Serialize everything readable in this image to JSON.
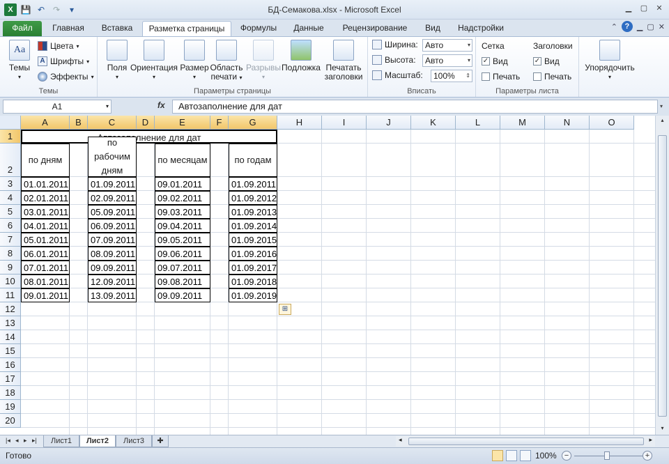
{
  "window": {
    "title": "БД-Семакова.xlsx - Microsoft Excel"
  },
  "ribbon_tabs": [
    "Файл",
    "Главная",
    "Вставка",
    "Разметка страницы",
    "Формулы",
    "Данные",
    "Рецензирование",
    "Вид",
    "Надстройки"
  ],
  "ribbon": {
    "themes": {
      "themes_label": "Темы",
      "colors": "Цвета",
      "fonts": "Шрифты",
      "effects": "Эффекты",
      "group": "Темы"
    },
    "page_setup": {
      "margins": "Поля",
      "orientation": "Ориентация",
      "size": "Размер",
      "print_area_1": "Область",
      "print_area_2": "печати",
      "breaks": "Разрывы",
      "background": "Подложка",
      "print_titles_1": "Печатать",
      "print_titles_2": "заголовки",
      "group": "Параметры страницы"
    },
    "fit": {
      "width_label": "Ширина:",
      "width_value": "Авто",
      "height_label": "Высота:",
      "height_value": "Авто",
      "scale_label": "Масштаб:",
      "scale_value": "100%",
      "group": "Вписать"
    },
    "sheet_options": {
      "gridlines": "Сетка",
      "headings": "Заголовки",
      "view": "Вид",
      "print": "Печать",
      "group": "Параметры листа"
    },
    "arrange": {
      "label": "Упорядочить"
    }
  },
  "formula_bar": {
    "name_box": "A1",
    "fx": "fx",
    "content": "Автозаполнение для дат"
  },
  "columns": [
    "A",
    "B",
    "C",
    "D",
    "E",
    "F",
    "G",
    "H",
    "I",
    "J",
    "K",
    "L",
    "M",
    "N",
    "O"
  ],
  "rows": [
    "1",
    "2",
    "3",
    "4",
    "5",
    "6",
    "7",
    "8",
    "9",
    "10",
    "11",
    "12",
    "13",
    "14",
    "15",
    "16",
    "17",
    "18",
    "19",
    "20"
  ],
  "table": {
    "title": "Автозаполнение для дат",
    "headers": {
      "by_days": "по дням",
      "by_workdays_1": "по",
      "by_workdays_2": "рабочим",
      "by_workdays_3": "дням",
      "by_months": "по месяцам",
      "by_years": "по годам"
    },
    "by_days": [
      "01.01.2011",
      "02.01.2011",
      "03.01.2011",
      "04.01.2011",
      "05.01.2011",
      "06.01.2011",
      "07.01.2011",
      "08.01.2011",
      "09.01.2011"
    ],
    "by_workdays": [
      "01.09.2011",
      "02.09.2011",
      "05.09.2011",
      "06.09.2011",
      "07.09.2011",
      "08.09.2011",
      "09.09.2011",
      "12.09.2011",
      "13.09.2011"
    ],
    "by_months": [
      "09.01.2011",
      "09.02.2011",
      "09.03.2011",
      "09.04.2011",
      "09.05.2011",
      "09.06.2011",
      "09.07.2011",
      "09.08.2011",
      "09.09.2011"
    ],
    "by_years": [
      "01.09.2011",
      "01.09.2012",
      "01.09.2013",
      "01.09.2014",
      "01.09.2015",
      "01.09.2016",
      "01.09.2017",
      "01.09.2018",
      "01.09.2019"
    ]
  },
  "sheet_tabs": [
    "Лист1",
    "Лист2",
    "Лист3"
  ],
  "active_sheet": "Лист2",
  "status": {
    "ready": "Готово",
    "zoom": "100%"
  },
  "colors": {
    "file_tab": "#2a7f33",
    "selection_header": "#f2c66a",
    "header_bg": "#e4ecf7"
  }
}
